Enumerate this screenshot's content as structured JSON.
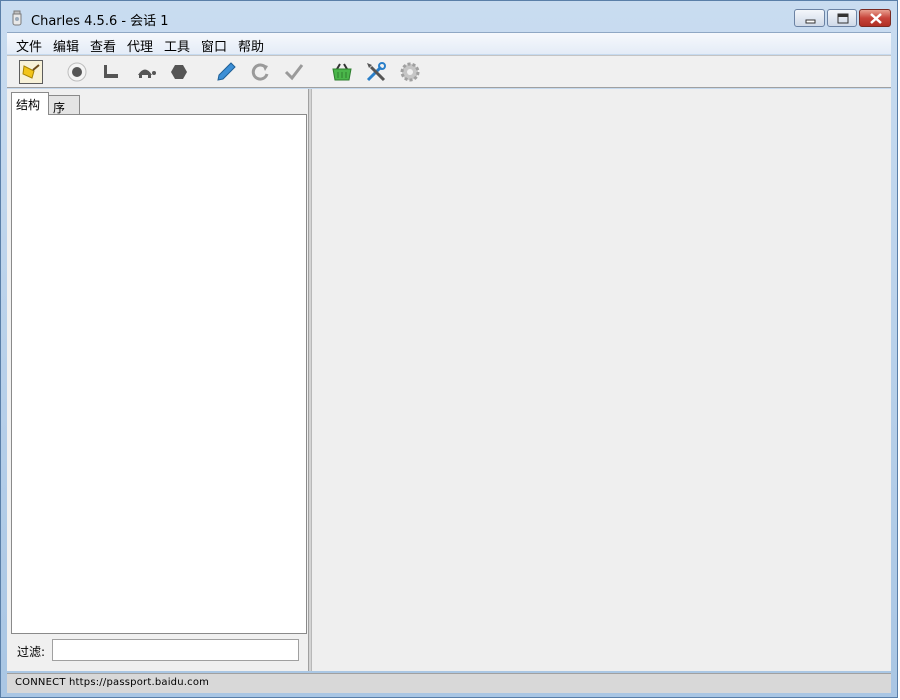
{
  "window": {
    "title": "Charles 4.5.6 - 会话 1",
    "app_icon": "charles-jug-icon",
    "controls": [
      "minimize-icon",
      "maximize-icon",
      "close-icon"
    ]
  },
  "menu": {
    "items": [
      "文件",
      "编辑",
      "查看",
      "代理",
      "工具",
      "窗口",
      "帮助"
    ]
  },
  "toolbar": {
    "buttons": [
      {
        "icon": "broom-icon",
        "selected": true
      },
      {
        "icon": "record-icon"
      },
      {
        "icon": "breakpoint-icon"
      },
      {
        "icon": "turtle-icon"
      },
      {
        "icon": "stop-hexagon-icon"
      },
      {
        "icon": "pen-icon"
      },
      {
        "icon": "refresh-icon"
      },
      {
        "icon": "checkmark-icon"
      },
      {
        "icon": "basket-icon"
      },
      {
        "icon": "tools-icon"
      },
      {
        "icon": "gear-icon"
      }
    ]
  },
  "left_panel": {
    "tabs": [
      {
        "label": "结构",
        "active": true
      },
      {
        "label": "序列",
        "active": false
      }
    ],
    "filter_label": "过滤:",
    "filter_value": ""
  },
  "status": {
    "text": "CONNECT https://passport.baidu.com"
  },
  "colors": {
    "title_gradient_top": "#c9dcf0",
    "close_button": "#c7443a",
    "panel_bg": "#f0f0f0"
  }
}
